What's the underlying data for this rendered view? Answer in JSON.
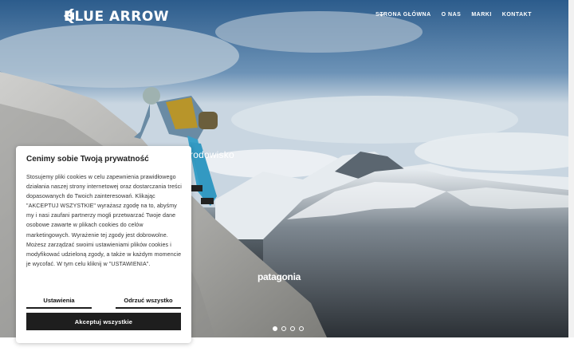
{
  "header": {
    "logo_text": "BLUE ARROW",
    "nav": [
      {
        "label": "STRONA GŁÓWNA"
      },
      {
        "label": "O NAS"
      },
      {
        "label": "MARKI"
      },
      {
        "label": "KONTAKT"
      }
    ]
  },
  "hero": {
    "subtitle_fragment": "rodowisko",
    "brand_logo_text": "patagonia",
    "slides_total": 4,
    "active_slide": 1
  },
  "cookie": {
    "title": "Cenimy sobie Twoją prywatność",
    "body": "Stosujemy pliki cookies w celu zapewnienia prawidłowego działania naszej strony internetowej oraz dostarczania treści dopasowanych do Twoich zainteresowań. Klikając \"AKCEPTUJ WSZYSTKIE\" wyrażasz zgodę na to, abyśmy my i nasi zaufani partnerzy mogli przetwarzać Twoje dane osobowe zawarte w plikach cookies do celów marketingowych. Wyrażenie tej zgody jest dobrowolne. Możesz zarządzać swoimi ustawieniami plików cookies i modyfikować udzieloną zgody, a także w każdym momencie je wycofać. W tym celu kliknij w \"USTAWIENIA\".",
    "settings_label": "Ustawienia",
    "reject_label": "Odrzuć wszystko",
    "accept_label": "Akceptuj wszystkie"
  },
  "colors": {
    "button_dark": "#1e1e1e",
    "text_dark": "#222222",
    "white": "#ffffff"
  }
}
